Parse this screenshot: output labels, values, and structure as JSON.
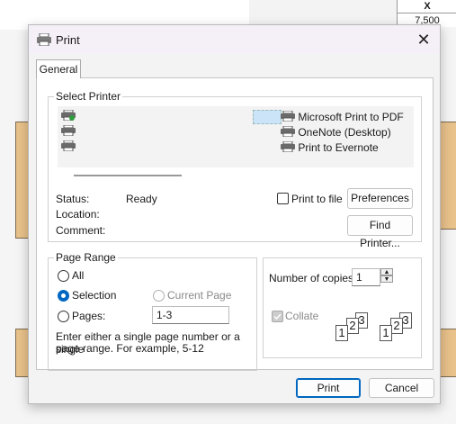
{
  "background": {
    "table_header": "X",
    "table_value": "7,500"
  },
  "dialog": {
    "title": "Print",
    "close_icon": "close-icon",
    "tab_general": "General"
  },
  "select_printer": {
    "group_label": "Select Printer",
    "printers": [
      {
        "name": "",
        "icon": "printer-default-icon"
      },
      {
        "name": "",
        "icon": "printer-icon"
      },
      {
        "name": "",
        "icon": "printer-icon"
      },
      {
        "name": "Microsoft Print to PDF",
        "icon": "printer-icon"
      },
      {
        "name": "OneNote (Desktop)",
        "icon": "printer-icon"
      },
      {
        "name": "Print to Evernote",
        "icon": "printer-icon"
      }
    ],
    "status_label": "Status:",
    "status_value": "Ready",
    "location_label": "Location:",
    "comment_label": "Comment:",
    "print_to_file_label": "Print to file",
    "print_to_file_checked": false,
    "preferences_button": "Preferences",
    "find_printer_button": "Find Printer..."
  },
  "page_range": {
    "group_label": "Page Range",
    "all_label": "All",
    "selection_label": "Selection",
    "current_page_label": "Current Page",
    "pages_label": "Pages:",
    "pages_value": "1-3",
    "selected_option": "Selection",
    "help_text_line1": "Enter either a single page number or a single",
    "help_text_line2": "page range.  For example, 5-12"
  },
  "copies": {
    "label": "Number of copies:",
    "value": "1",
    "collate_label": "Collate",
    "collate_checked": true,
    "collate_disabled": true,
    "collate_icon": "collate-pages-icon",
    "page_numbers": [
      "1",
      "2",
      "3"
    ]
  },
  "footer": {
    "print_button": "Print",
    "cancel_button": "Cancel"
  },
  "colors": {
    "accent": "#0067c0",
    "dialog_bg": "#f3f3f3",
    "background_tan": "#e9c28b"
  }
}
